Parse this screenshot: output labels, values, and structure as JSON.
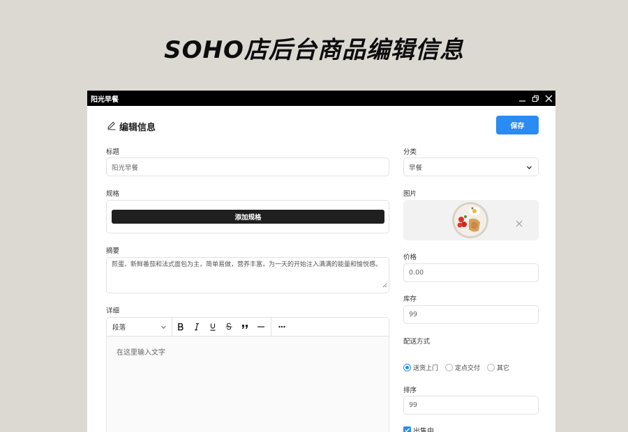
{
  "banner": {
    "title": "SOHO店后台商品编辑信息"
  },
  "window": {
    "title": "阳光早餐",
    "controls": {
      "minimize": "minimize-icon",
      "restore": "restore-icon",
      "close": "close-icon"
    }
  },
  "form": {
    "heading": "编辑信息",
    "save_label": "保存",
    "title_label": "标题",
    "title_value": "阳光早餐",
    "spec_label": "规格",
    "spec_button": "添加规格",
    "summary_label": "摘要",
    "summary_value": "煎蛋、新鲜番茄和法式面包为主，简单易做，营养丰富，为一天的开始注入满满的能量和愉悦感。",
    "detail_label": "详细",
    "editor": {
      "paragraph": "段落",
      "tools": [
        "bold",
        "italic",
        "underline",
        "strikethrough",
        "quote",
        "horizontal-rule",
        "more"
      ],
      "placeholder": "在这里输入文字"
    },
    "category_label": "分类",
    "category_value": "早餐",
    "image_label": "图片",
    "price_label": "价格",
    "price_value": "0.00",
    "stock_label": "库存",
    "stock_value": "99",
    "delivery_label": "配送方式",
    "delivery_options": [
      {
        "label": "送货上门",
        "selected": true
      },
      {
        "label": "定点交付",
        "selected": false
      },
      {
        "label": "其它",
        "selected": false
      }
    ],
    "sort_label": "排序",
    "sort_value": "99",
    "on_sale_label": "出售中",
    "on_sale_checked": true
  },
  "colors": {
    "accent": "#2a8bf2",
    "titlebar": "#000000",
    "background": "#dcd9d3"
  }
}
